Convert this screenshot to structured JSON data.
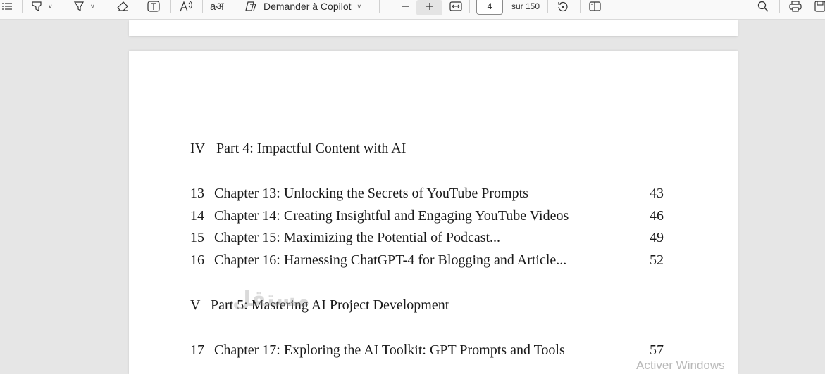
{
  "toolbar": {
    "copilot_label": "Demander à Copilot",
    "page_number": "4",
    "page_total": "sur 150"
  },
  "toc": {
    "parts": [
      {
        "num": "IV",
        "title": "Part 4: Impactful Content with AI",
        "chapters": [
          {
            "num": "13",
            "title": "Chapter 13: Unlocking the Secrets of YouTube Prompts",
            "page": "43"
          },
          {
            "num": "14",
            "title": "Chapter 14: Creating Insightful and Engaging YouTube Videos",
            "page": "46"
          },
          {
            "num": "15",
            "title": "Chapter 15: Maximizing the Potential of Podcast...",
            "page": "49"
          },
          {
            "num": "16",
            "title": "Chapter 16: Harnessing ChatGPT-4 for Blogging and Article...",
            "page": "52"
          }
        ]
      },
      {
        "num": "V",
        "title": "Part 5: Mastering AI Project Development",
        "chapters": [
          {
            "num": "17",
            "title": "Chapter 17: Exploring the AI Toolkit: GPT Prompts and Tools",
            "page": "57"
          }
        ]
      }
    ]
  },
  "overlay": {
    "watermark": "مستقل",
    "activate_windows": "Activer Windows"
  }
}
